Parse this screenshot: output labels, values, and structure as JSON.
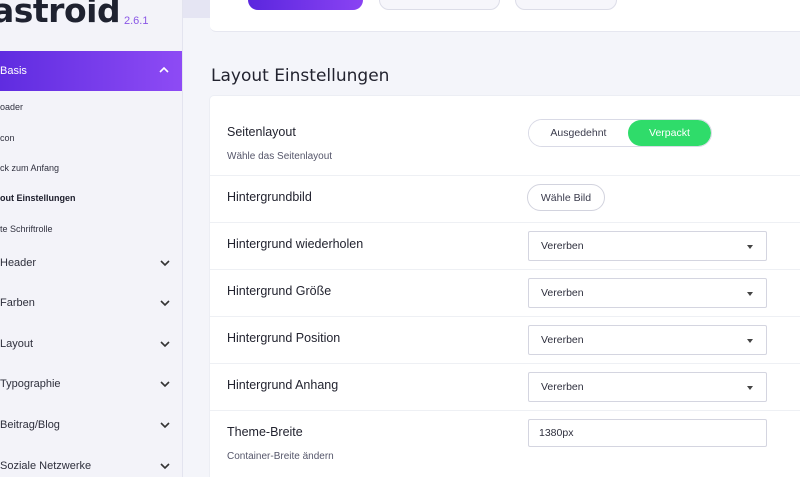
{
  "app": {
    "logo": "astroid",
    "version": "2.6.1"
  },
  "sidebar": {
    "active_group": "Basis",
    "sub_items": [
      "oader",
      "con",
      "ck zum Anfang",
      "out Einstellungen",
      "te Schriftrolle"
    ],
    "groups": [
      "Header",
      "Farben",
      "Layout",
      "Typographie",
      "Beitrag/Blog",
      "Soziale Netzwerke"
    ]
  },
  "section": {
    "title": "Layout Einstellungen"
  },
  "settings": {
    "layout": {
      "label": "Seitenlayout",
      "desc": "Wähle das Seitenlayout",
      "option_a": "Ausgedehnt",
      "option_b": "Verpackt",
      "selected": "Verpackt"
    },
    "bg_image": {
      "label": "Hintergrundbild",
      "button": "Wähle Bild"
    },
    "bg_repeat": {
      "label": "Hintergrund wiederholen",
      "value": "Vererben"
    },
    "bg_size": {
      "label": "Hintergrund Größe",
      "value": "Vererben"
    },
    "bg_position": {
      "label": "Hintergrund Position",
      "value": "Vererben"
    },
    "bg_attach": {
      "label": "Hintergrund Anhang",
      "value": "Vererben"
    },
    "theme_width": {
      "label": "Theme-Breite",
      "desc": "Container-Breite ändern",
      "value": "1380px"
    }
  },
  "colors": {
    "accent": "#6a34e6",
    "toggle_on": "#2fdc6a"
  }
}
